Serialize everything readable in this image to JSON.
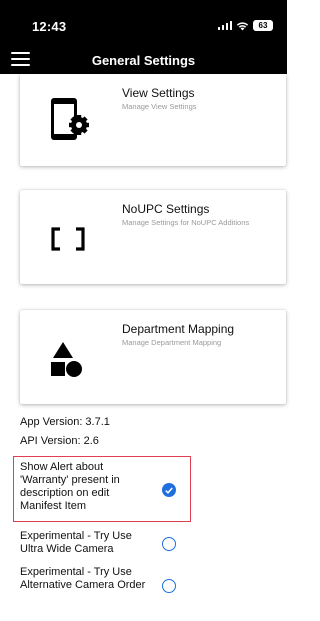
{
  "status_bar": {
    "time": "12:43",
    "battery": "63",
    "icons": [
      "signal-icon",
      "wifi-icon",
      "battery-icon"
    ]
  },
  "header": {
    "title": "General Settings",
    "menu_icon": "hamburger-menu-icon"
  },
  "cards": [
    {
      "title": "View Settings",
      "subtitle": "Manage View Settings",
      "icon": "phone-settings-icon"
    },
    {
      "title": "NoUPC Settings",
      "subtitle": "Manage Settings for NoUPC Additions",
      "icon": "brackets-icon"
    },
    {
      "title": "Department Mapping",
      "subtitle": "Manage Department Mapping",
      "icon": "shapes-icon"
    }
  ],
  "app_version": "App Version: 3.7.1",
  "api_version": "API Version: 2.6",
  "settings": [
    {
      "label": "Show Alert about 'Warranty' present in description on edit Manifest Item",
      "checked": true
    },
    {
      "label": "Experimental - Try Use Ultra Wide Camera",
      "checked": false
    },
    {
      "label": "Experimental - Try Use Alternative Camera Order",
      "checked": false
    }
  ],
  "colors": {
    "accent": "#1f6fe0",
    "highlight_border": "#e04050",
    "header_bg": "#000000"
  }
}
